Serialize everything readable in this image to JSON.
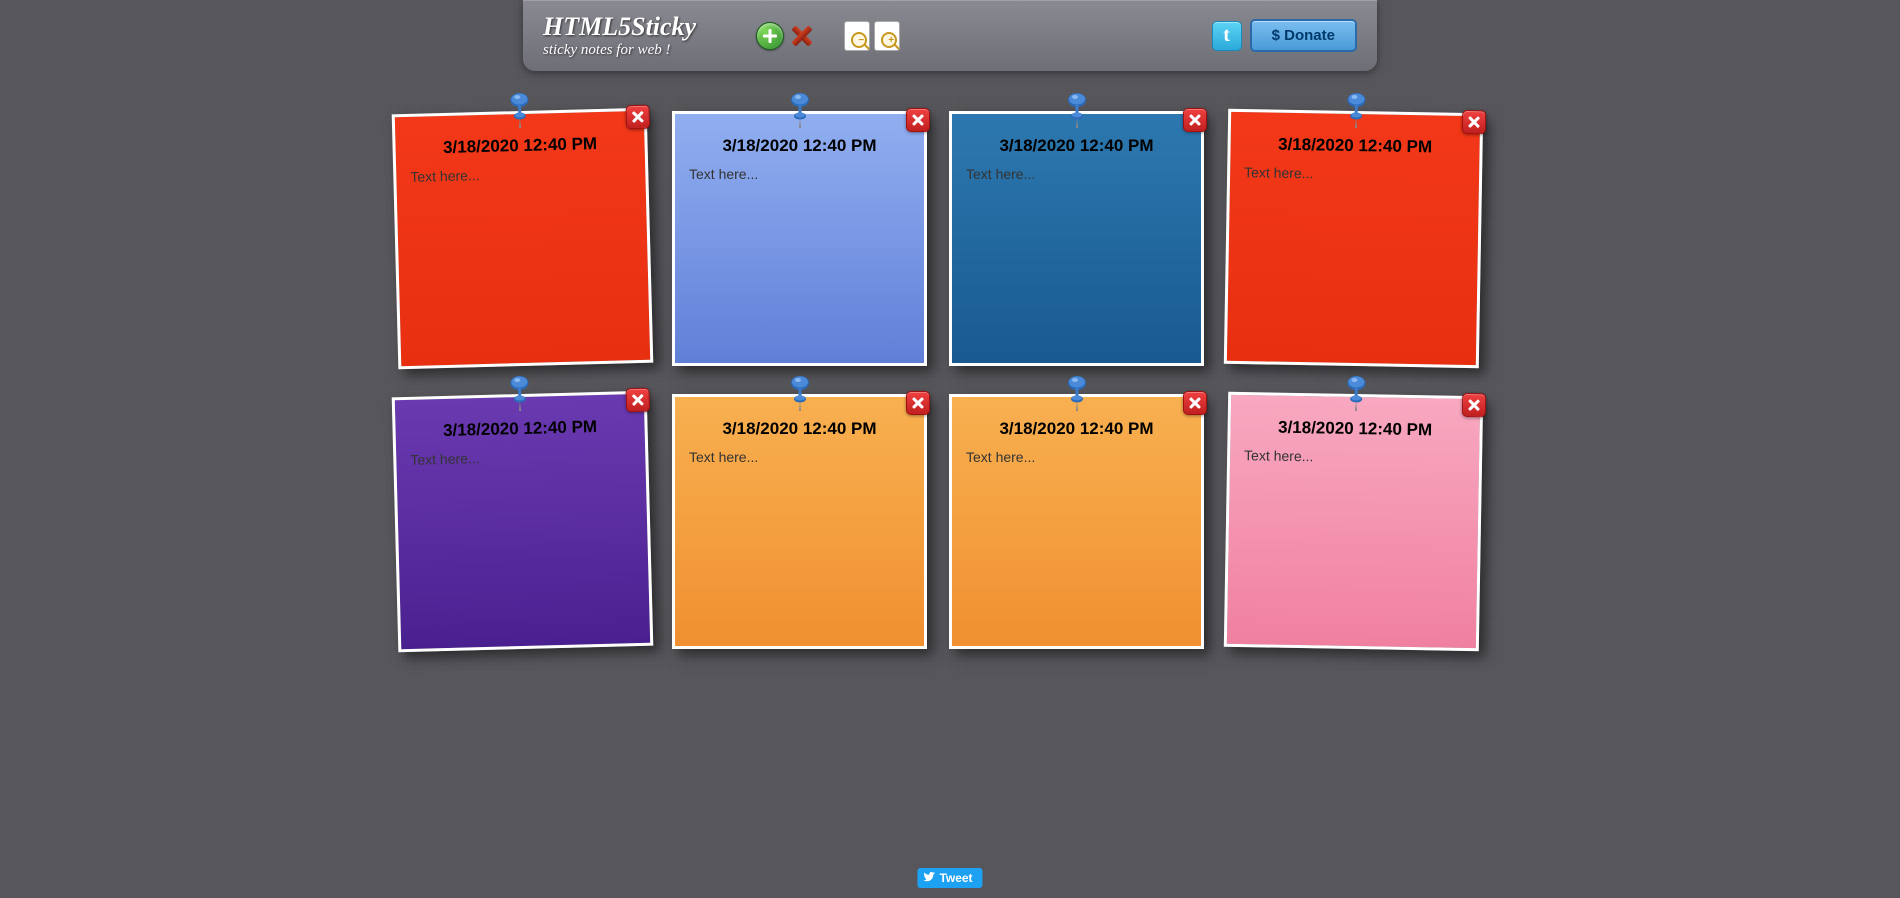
{
  "header": {
    "title": "HTML5Sticky",
    "subtitle": "sticky notes for web !",
    "donate_label": "$ Donate",
    "twitter_glyph": "t"
  },
  "notes": [
    {
      "date": "3/18/2020 12:40 PM",
      "text": "Text here...",
      "color": "red",
      "rot": "rot-l"
    },
    {
      "date": "3/18/2020 12:40 PM",
      "text": "Text here...",
      "color": "lightblue",
      "rot": ""
    },
    {
      "date": "3/18/2020 12:40 PM",
      "text": "Text here...",
      "color": "darkblue",
      "rot": ""
    },
    {
      "date": "3/18/2020 12:40 PM",
      "text": "Text here...",
      "color": "red",
      "rot": "rot-r"
    },
    {
      "date": "3/18/2020 12:40 PM",
      "text": "Text here...",
      "color": "purple",
      "rot": "rot-l"
    },
    {
      "date": "3/18/2020 12:40 PM",
      "text": "Text here...",
      "color": "orange",
      "rot": ""
    },
    {
      "date": "3/18/2020 12:40 PM",
      "text": "Text here...",
      "color": "orange",
      "rot": ""
    },
    {
      "date": "3/18/2020 12:40 PM",
      "text": "Text here...",
      "color": "pink",
      "rot": "rot-r"
    }
  ],
  "tweet_label": "Tweet"
}
